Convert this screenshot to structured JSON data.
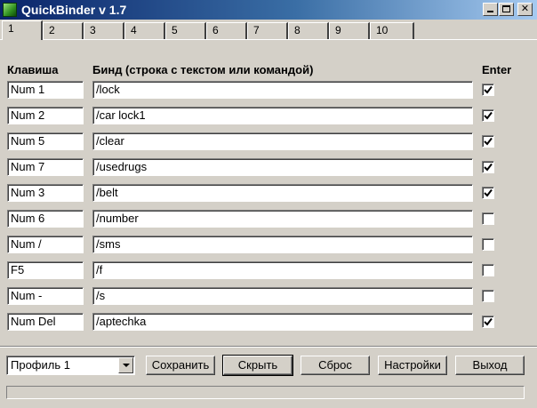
{
  "window": {
    "title": "QuickBinder v 1.7"
  },
  "tabs": [
    "1",
    "2",
    "3",
    "4",
    "5",
    "6",
    "7",
    "8",
    "9",
    "10"
  ],
  "active_tab": "1",
  "columns": {
    "key": "Клавиша",
    "bind": "Бинд (строка с текстом или командой)",
    "enter": "Enter"
  },
  "rows": [
    {
      "key": "Num 1",
      "bind": "/lock",
      "enter": true
    },
    {
      "key": "Num 2",
      "bind": "/car lock1",
      "enter": true
    },
    {
      "key": "Num 5",
      "bind": "/clear",
      "enter": true
    },
    {
      "key": "Num 7",
      "bind": "/usedrugs",
      "enter": true
    },
    {
      "key": "Num 3",
      "bind": "/belt",
      "enter": true
    },
    {
      "key": "Num 6",
      "bind": "/number",
      "enter": false
    },
    {
      "key": "Num /",
      "bind": "/sms",
      "enter": false
    },
    {
      "key": "F5",
      "bind": "/f",
      "enter": false
    },
    {
      "key": "Num -",
      "bind": "/s",
      "enter": false
    },
    {
      "key": "Num Del",
      "bind": "/aptechka",
      "enter": true
    }
  ],
  "footer": {
    "profile_selected": "Профиль 1",
    "buttons": {
      "save": "Сохранить",
      "hide": "Скрыть",
      "reset": "Сброс",
      "settings": "Настройки",
      "exit": "Выход"
    }
  }
}
